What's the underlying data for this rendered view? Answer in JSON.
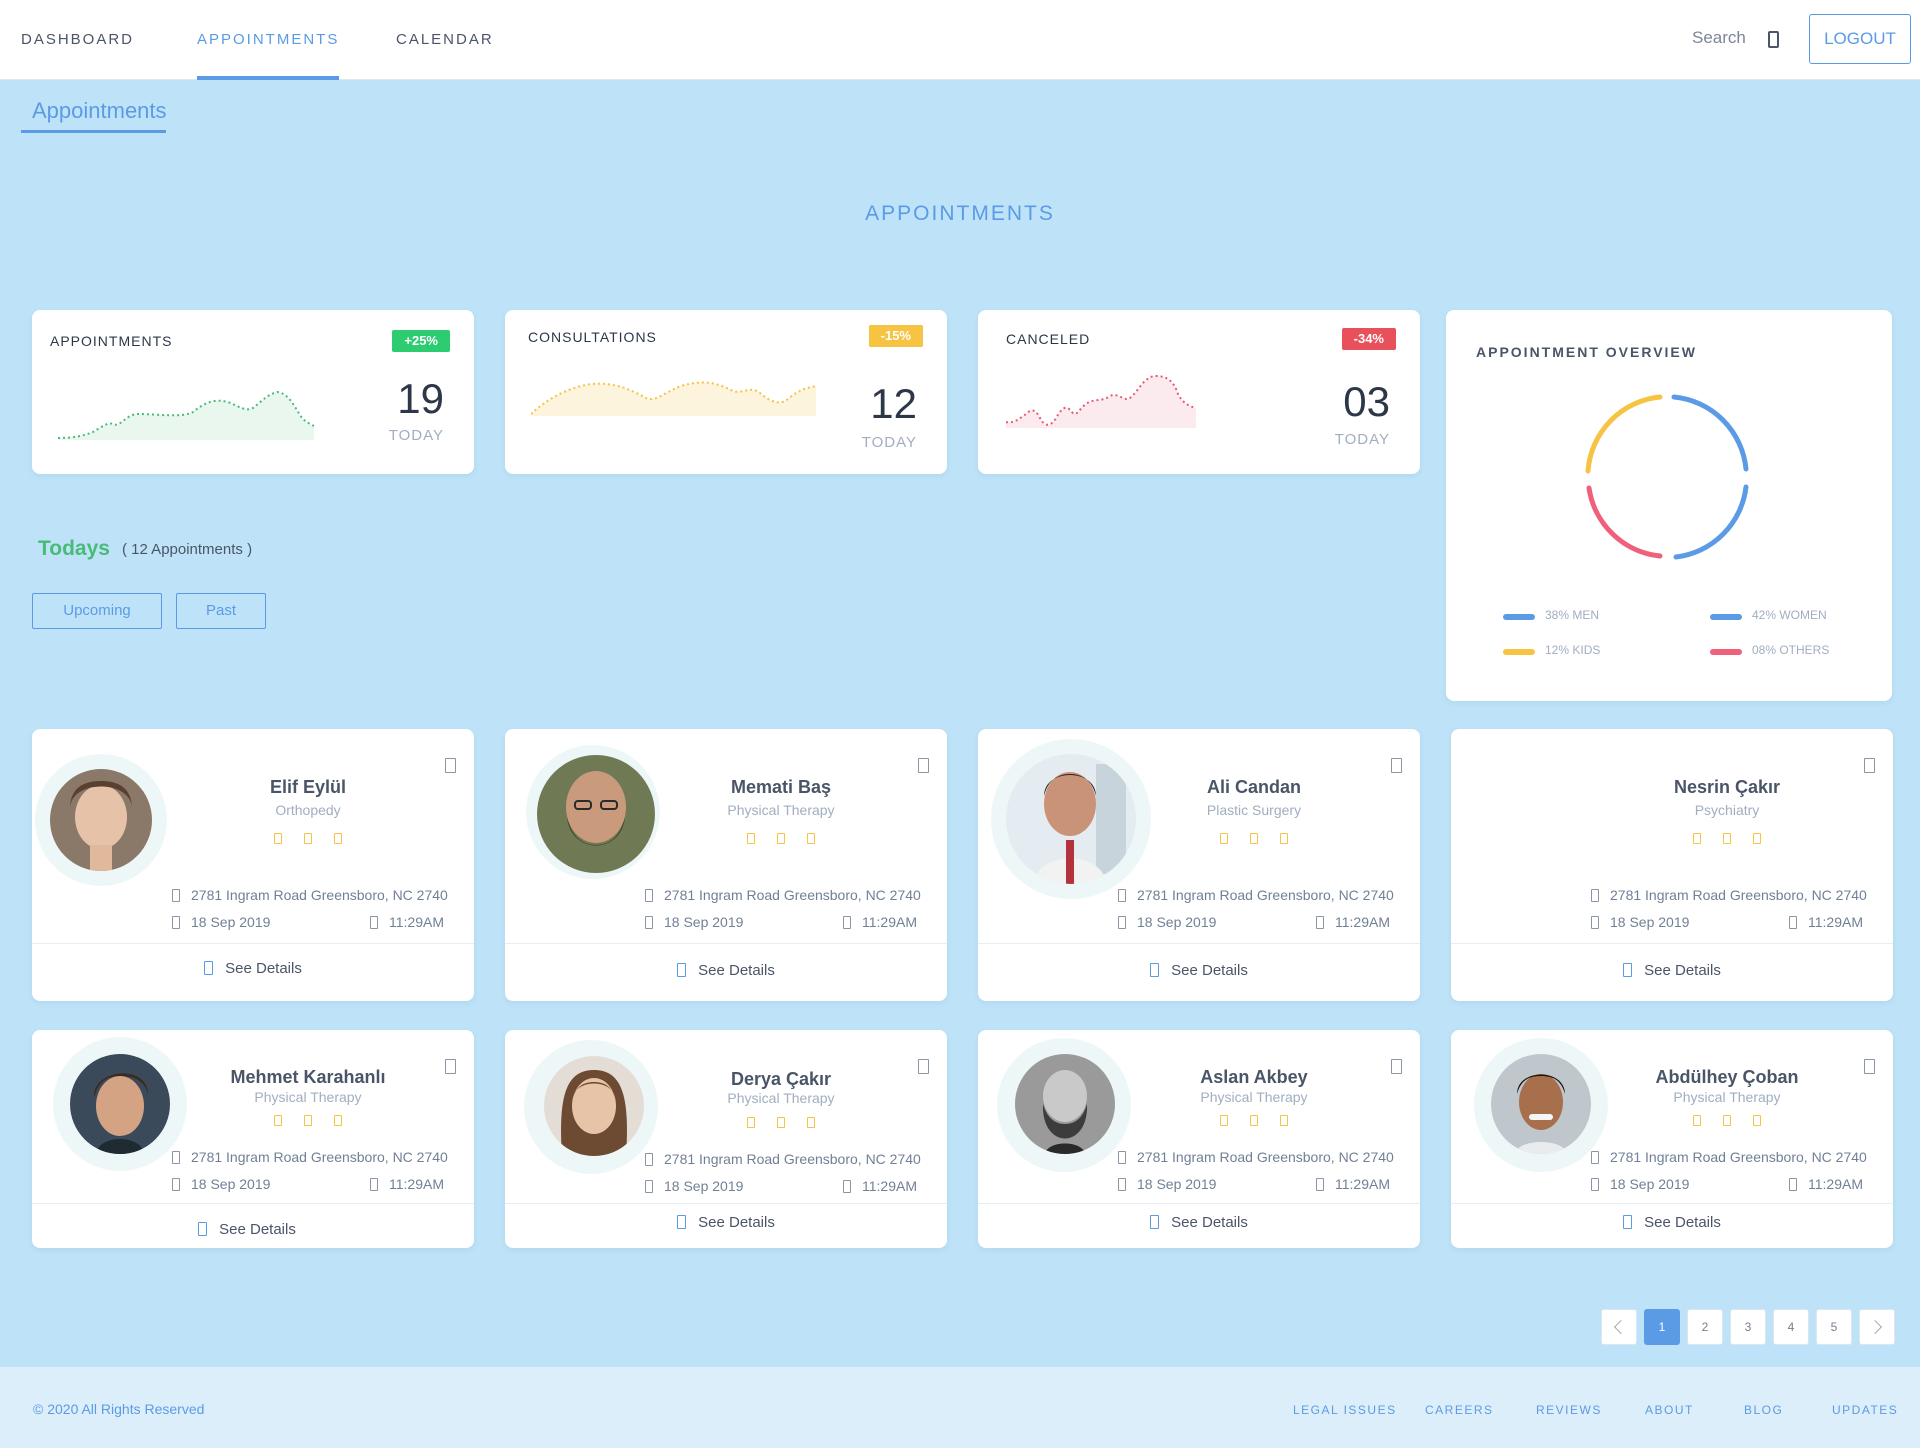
{
  "nav": {
    "tabs": [
      {
        "label": "DASHBOARD"
      },
      {
        "label": "APPOINTMENTS",
        "active": true
      },
      {
        "label": "CALENDAR"
      }
    ],
    "search_label": "Search",
    "search_icon": "search-icon",
    "logout_label": "LOGOUT"
  },
  "breadcrumb": "Appointments",
  "page_title": "APPOINTMENTS",
  "stats": [
    {
      "title": "APPOINTMENTS",
      "badge": "+25%",
      "badge_color": "#2ecc71",
      "value": "19",
      "sub": "TODAY",
      "line_color": "#48bb78"
    },
    {
      "title": "CONSULTATIONS",
      "badge": "-15%",
      "badge_color": "#f6c343",
      "value": "12",
      "sub": "TODAY",
      "line_color": "#f6c343"
    },
    {
      "title": "CANCELED",
      "badge": "-34%",
      "badge_color": "#e8505b",
      "value": "03",
      "sub": "TODAY",
      "line_color": "#e85a72"
    }
  ],
  "overview": {
    "title": "APPOINTMENT OVERVIEW",
    "segments": [
      {
        "label": "38% MEN",
        "value": 38,
        "color": "#5b9be6"
      },
      {
        "label": "42% WOMEN",
        "value": 42,
        "color": "#5b9be6"
      },
      {
        "label": "12% KIDS",
        "value": 12,
        "color": "#f6c343"
      },
      {
        "label": "08% OTHERS",
        "value": 8,
        "color": "#f0607a"
      }
    ]
  },
  "todays": {
    "title": "Todays",
    "count": "( 12 Appointments )",
    "filters": [
      "Upcoming",
      "Past"
    ]
  },
  "doctors": [
    {
      "name": "Elif Eylül",
      "specialty": "Orthopedy",
      "address": "2781 Ingram Road Greensboro, NC 2740",
      "date": "18 Sep 2019",
      "time": "11:29AM",
      "details": "See Details"
    },
    {
      "name": "Memati Baş",
      "specialty": "Physical Therapy",
      "address": "2781 Ingram Road Greensboro, NC 2740",
      "date": "18 Sep 2019",
      "time": "11:29AM",
      "details": "See Details"
    },
    {
      "name": "Ali Candan",
      "specialty": "Plastic Surgery",
      "address": "2781 Ingram Road Greensboro, NC 2740",
      "date": "18 Sep 2019",
      "time": "11:29AM",
      "details": "See Details"
    },
    {
      "name": "Nesrin Çakır",
      "specialty": "Psychiatry",
      "address": "2781 Ingram Road Greensboro, NC 2740",
      "date": "18 Sep 2019",
      "time": "11:29AM",
      "details": "See Details"
    },
    {
      "name": "Mehmet Karahanlı",
      "specialty": "Physical Therapy",
      "address": "2781 Ingram Road Greensboro, NC 2740",
      "date": "18 Sep 2019",
      "time": "11:29AM",
      "details": "See Details"
    },
    {
      "name": "Derya Çakır",
      "specialty": "Physical Therapy",
      "address": "2781 Ingram Road Greensboro, NC 2740",
      "date": "18 Sep 2019",
      "time": "11:29AM",
      "details": "See Details"
    },
    {
      "name": "Aslan Akbey",
      "specialty": "Physical Therapy",
      "address": "2781 Ingram Road Greensboro, NC 2740",
      "date": "18 Sep 2019",
      "time": "11:29AM",
      "details": "See Details"
    },
    {
      "name": "Abdülhey Çoban",
      "specialty": "Physical Therapy",
      "address": "2781 Ingram Road Greensboro, NC 2740",
      "date": "18 Sep 2019",
      "time": "11:29AM",
      "details": "See Details"
    }
  ],
  "pagination": {
    "pages": [
      "1",
      "2",
      "3",
      "4",
      "5"
    ],
    "current": "1"
  },
  "footer": {
    "copyright": "© 2020 All Rights Reserved",
    "links": [
      "LEGAL ISSUES",
      "CAREERS",
      "REVIEWS",
      "ABOUT",
      "BLOG",
      "UPDATES"
    ]
  }
}
